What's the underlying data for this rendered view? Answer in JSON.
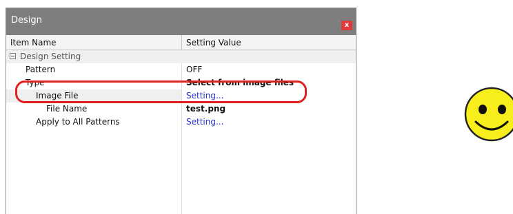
{
  "window": {
    "title": "Design",
    "close_label": "x"
  },
  "grid": {
    "columns": [
      "Item Name",
      "Setting Value"
    ],
    "group": {
      "label": "Design Setting",
      "expanded": true
    },
    "rows": [
      {
        "name": "Pattern",
        "value": "OFF"
      },
      {
        "name": "Type",
        "value": "Select from image files"
      },
      {
        "name": "Image File",
        "value": "Setting..."
      },
      {
        "name": "File Name",
        "value": "test.png"
      },
      {
        "name": "Apply to All Patterns",
        "value": "Setting..."
      }
    ]
  },
  "colors": {
    "titlebar": "#7e7e7e",
    "close_button": "#e23a3a",
    "highlight": "#e02020",
    "link": "#2233cc",
    "smiley": "#f7ee1c"
  },
  "icons": [
    "collapse-icon",
    "close-icon",
    "smiley-face-icon"
  ]
}
